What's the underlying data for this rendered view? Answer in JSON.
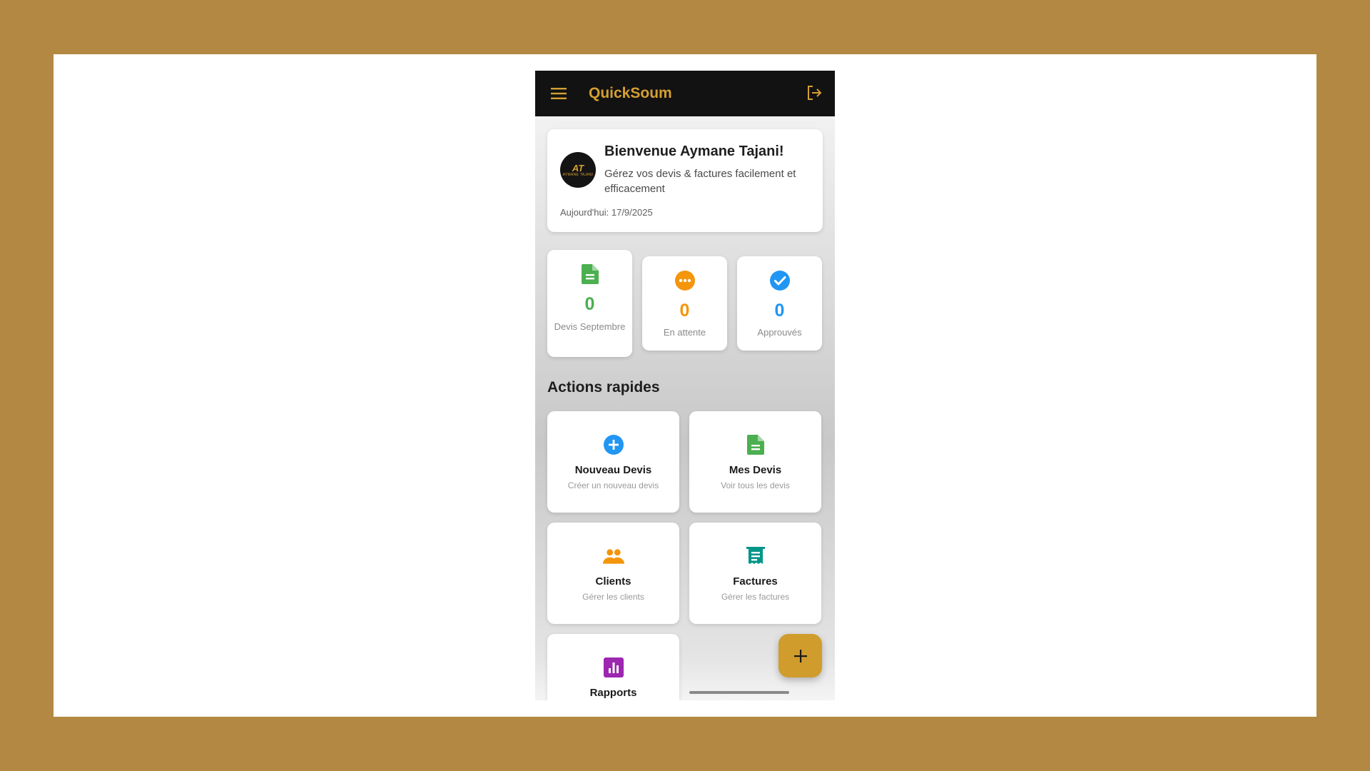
{
  "app": {
    "title": "QuickSoum"
  },
  "header": {
    "menu_icon": "menu-icon",
    "logout_icon": "logout-icon"
  },
  "welcome": {
    "avatar_text": "AT",
    "avatar_subtext": "AYMANE TAJANI",
    "title": "Bienvenue Aymane Tajani!",
    "subtitle": "Gérez vos devis & factures facilement et efficacement",
    "date": "Aujourd'hui: 17/9/2025"
  },
  "stats": [
    {
      "value": "0",
      "label": "Devis Septembre",
      "icon": "document-icon",
      "color": "#4caf50"
    },
    {
      "value": "0",
      "label": "En attente",
      "icon": "pending-icon",
      "color": "#f4950c"
    },
    {
      "value": "0",
      "label": "Approuvés",
      "icon": "check-circle-icon",
      "color": "#2196f3"
    }
  ],
  "quick_actions": {
    "title": "Actions rapides",
    "items": [
      {
        "title": "Nouveau Devis",
        "subtitle": "Créer un nouveau devis",
        "icon": "add-circle-icon",
        "color": "#2196f3"
      },
      {
        "title": "Mes Devis",
        "subtitle": "Voir tous les devis",
        "icon": "document-icon",
        "color": "#4caf50"
      },
      {
        "title": "Clients",
        "subtitle": "Gérer les clients",
        "icon": "people-icon",
        "color": "#f4950c"
      },
      {
        "title": "Factures",
        "subtitle": "Gérer les factures",
        "icon": "receipt-icon",
        "color": "#009688"
      },
      {
        "title": "Rapports",
        "subtitle": "",
        "icon": "bar-chart-icon",
        "color": "#9c27b0"
      }
    ]
  },
  "fab": {
    "icon": "plus-icon"
  },
  "colors": {
    "brand": "#d4a032",
    "appbar": "#121212",
    "fab": "#d09c2c",
    "frame": "#b28842"
  }
}
